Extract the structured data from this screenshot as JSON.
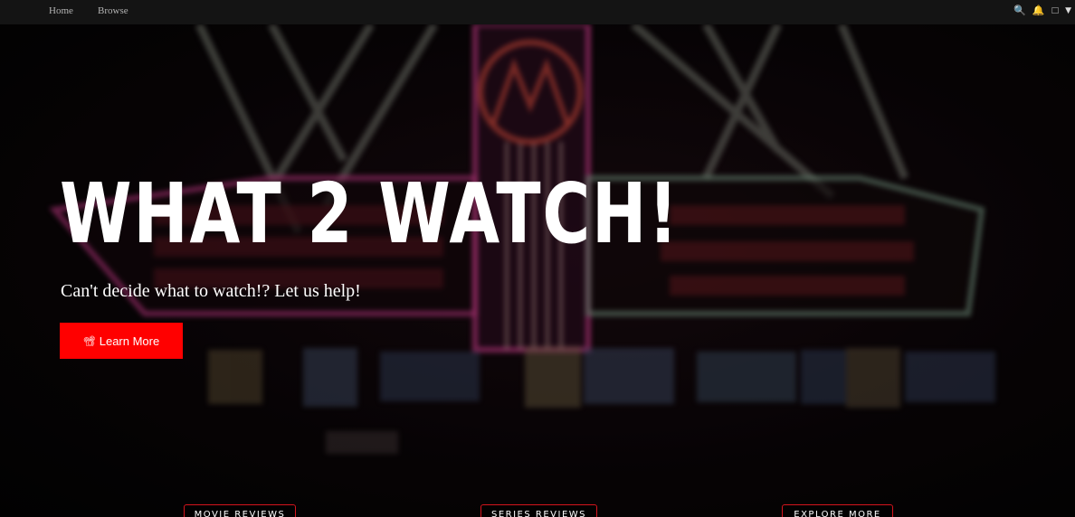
{
  "nav": {
    "home": "Home",
    "browse": "Browse",
    "icons": [
      "search-icon",
      "bell-icon",
      "profile-icon",
      "caret-down-icon"
    ]
  },
  "hero": {
    "title": "WHAT 2 WATCH!",
    "subtitle": "Can't decide what to watch!? Let us help!",
    "cta_icon": "📽",
    "cta_label": "Learn More"
  },
  "sections": {
    "movie_reviews": "MOVIE REVIEWS",
    "series_reviews": "SERIES REVIEWS",
    "explore_more": "EXPLORE MORE"
  },
  "colors": {
    "accent": "#ff0000",
    "nav_bg": "#141414",
    "pill_border": "#d4141c"
  }
}
